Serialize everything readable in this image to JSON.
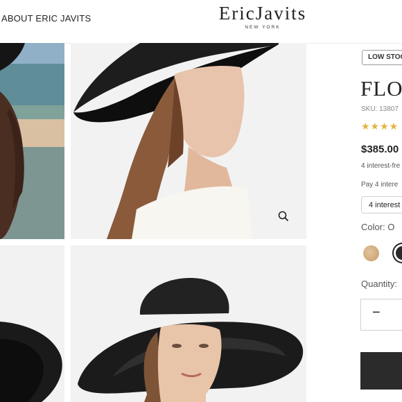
{
  "header": {
    "nav_about": "ABOUT ERIC JAVITS",
    "logo_main": "EricJavits",
    "logo_sub": "NEW YORK"
  },
  "gallery": {
    "images": [
      "beach-model-photo",
      "profile-model-black-hat-photo",
      "black-hat-brim-detail-photo",
      "model-front-black-hat-photo"
    ],
    "zoom_icon": "magnifier-icon"
  },
  "product": {
    "badge": "LOW STOC",
    "title": "FLOI",
    "sku": "SKU: 13807",
    "rating_stars": "★★★★",
    "price": "$385.00",
    "interest_line": "4 interest-fre",
    "pay_line": "Pay 4 intere",
    "installment_select": "4 interest",
    "color_label": "Color:  O",
    "swatches": [
      {
        "name": "natural",
        "color": "#d6b184"
      },
      {
        "name": "black",
        "color": "#2a2a2a",
        "selected": true
      }
    ],
    "quantity_label": "Quantity:",
    "qty_minus": "−"
  },
  "colors": {
    "star": "#e4b33f",
    "button_dark": "#2b2b2b"
  }
}
